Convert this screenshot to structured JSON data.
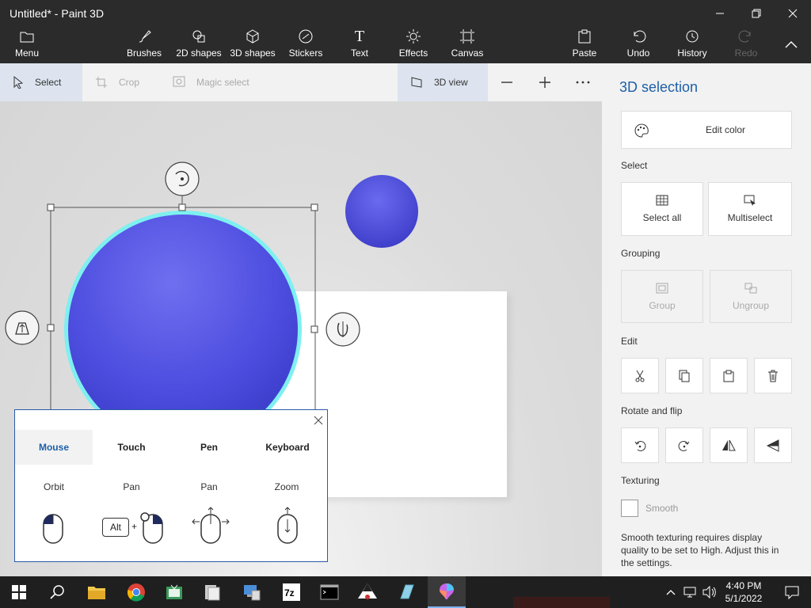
{
  "window": {
    "title": "Untitled* - Paint 3D"
  },
  "ribbon": {
    "menu": "Menu",
    "tools": [
      "Brushes",
      "2D shapes",
      "3D shapes",
      "Stickers",
      "Text",
      "Effects",
      "Canvas"
    ],
    "paste": "Paste",
    "undo": "Undo",
    "history": "History",
    "redo": "Redo"
  },
  "toolbar": {
    "select": "Select",
    "crop": "Crop",
    "magic_select": "Magic select",
    "view_3d": "3D view"
  },
  "panel": {
    "title": "3D selection",
    "edit_color": "Edit color",
    "select_label": "Select",
    "select_all": "Select all",
    "multiselect": "Multiselect",
    "grouping_label": "Grouping",
    "group": "Group",
    "ungroup": "Ungroup",
    "edit_label": "Edit",
    "rotate_label": "Rotate and flip",
    "texturing_label": "Texturing",
    "smooth": "Smooth",
    "smooth_note": "Smooth texturing requires display quality to be set to High. Adjust this in the settings."
  },
  "help": {
    "tabs": [
      "Mouse",
      "Touch",
      "Pen",
      "Keyboard"
    ],
    "active_tab": "Mouse",
    "actions": [
      "Orbit",
      "Pan",
      "Pan",
      "Zoom"
    ],
    "alt_key": "Alt",
    "plus": "+"
  },
  "taskbar": {
    "time": "4:40 PM",
    "date": "5/1/2022"
  },
  "colors": {
    "accent": "#1e5fa8",
    "sphere": "#4f4fe0",
    "selection_glow": "#7ef0f0"
  }
}
